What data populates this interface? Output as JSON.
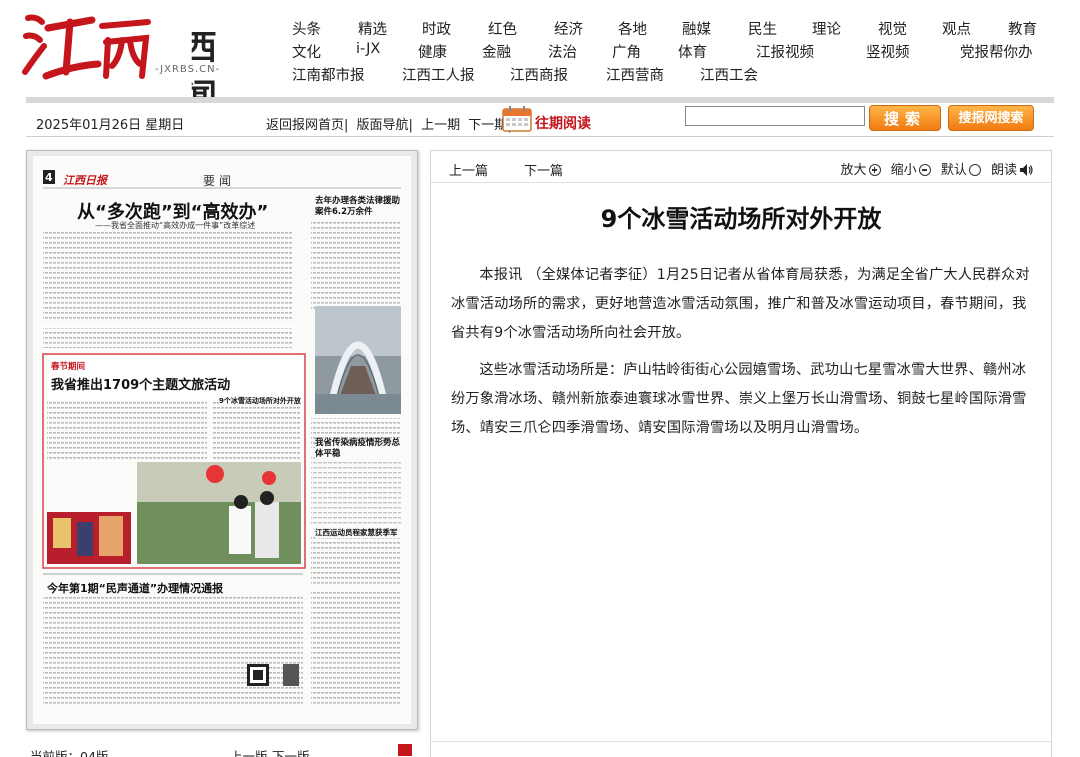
{
  "site": {
    "logo_text": "江西新闻",
    "logo_url_text": "-JXRBS.CN-"
  },
  "nav": {
    "row1": [
      "头条",
      "精选",
      "时政",
      "红色",
      "经济",
      "各地",
      "融媒",
      "民生",
      "理论",
      "视觉",
      "观点",
      "教育"
    ],
    "row2": [
      "文化",
      "i-JX",
      "健康",
      "金融",
      "法治",
      "广角",
      "体育",
      "江报视频",
      "竖视频",
      "党报帮你办"
    ],
    "row3": [
      "江南都市报",
      "江西工人报",
      "江西商报",
      "江西营商",
      "江西工会"
    ]
  },
  "toolbar": {
    "date": "2025年01月26日 星期日",
    "links": [
      "返回报网首页|",
      "版面导航|",
      "上一期",
      "下一期|"
    ],
    "past_read": "往期阅读",
    "search_value": "",
    "search_btn": "搜索",
    "search_site_btn": "搜报网搜索"
  },
  "paper": {
    "page_no": "4",
    "masthead": "江西日报",
    "section": "要闻",
    "headline1": "从“多次跑”到“高效办”",
    "subhead1": "——我省全面推动“高效办成一件事”改革综述",
    "side_head": "去年办理各类法律援助案件6.2万余件",
    "box_kicker": "春节期间",
    "box_headline": "我省推出1709个主题文旅活动",
    "teaser": "9个冰雪活动场所对外开放",
    "side_head2": "我省传染病疫情形势总体平稳",
    "side_head3": "江西运动员程家慧获季军",
    "bottom_headline": "今年第1期“民声通道”办理情况通报"
  },
  "bottom": {
    "current_label": "当前版：04版",
    "prev_page": "上一版",
    "next_page": "下一版"
  },
  "article": {
    "prev": "上一篇",
    "next": "下一篇",
    "zoom_in": "放大",
    "zoom_out": "缩小",
    "default": "默认",
    "read_aloud": "朗读",
    "title": "9个冰雪活动场所对外开放",
    "paragraphs": [
      "本报讯 （全媒体记者李征）1月25日记者从省体育局获悉，为满足全省广大人民群众对冰雪活动场所的需求，更好地营造冰雪活动氛围，推广和普及冰雪运动项目，春节期间，我省共有9个冰雪活动场所向社会开放。",
      "这些冰雪活动场所是：庐山牯岭街街心公园嬉雪场、武功山七星雪冰雪大世界、赣州冰纷万象滑冰场、赣州新旅泰迪寰球冰雪世界、崇义上堡万长山滑雪场、铜鼓七星岭国际滑雪场、靖安三爪仑四季滑雪场、靖安国际滑雪场以及明月山滑雪场。"
    ]
  },
  "colors": {
    "brand_red": "#c4161c",
    "button_orange": "#f07a10"
  }
}
